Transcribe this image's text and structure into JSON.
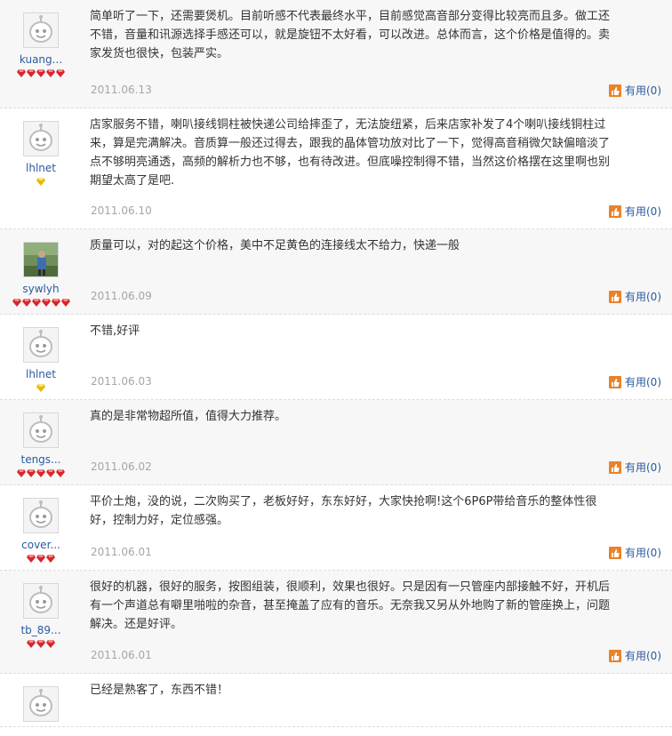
{
  "reviews": [
    {
      "username": "kuang...",
      "avatar": "default-face-icon",
      "rank": {
        "icon": "red-gem-icon",
        "count": 5
      },
      "text": "简单听了一下，还需要煲机。目前听感不代表最终水平，目前感觉高音部分变得比较亮而且多。做工还不错，音量和讯源选择手感还可以，就是旋钮不太好看，可以改进。总体而言，这个价格是值得的。卖家发货也很快，包装严实。",
      "date": "2011.06.13",
      "useful_label": "有用(0)"
    },
    {
      "username": "lhlnet",
      "avatar": "default-face-icon",
      "rank": {
        "icon": "yellow-diamond-icon",
        "count": 1
      },
      "text": "店家服务不错，喇叭接线铜柱被快递公司给摔歪了，无法旋纽紧，后来店家补发了4个喇叭接线铜柱过来，算是完满解决。音质算一般还过得去，跟我的晶体管功放对比了一下，觉得高音稍微欠缺偏暗淡了点不够明亮通透，高频的解析力也不够，也有待改进。但底噪控制得不错，当然这价格摆在这里啊也别期望太高了是吧.",
      "date": "2011.06.10",
      "useful_label": "有用(0)"
    },
    {
      "username": "sywlyh",
      "avatar": "user-photo",
      "rank": {
        "icon": "red-gem-icon",
        "count": 6
      },
      "text": "质量可以，对的起这个价格，美中不足黄色的连接线太不给力，快递一般",
      "date": "2011.06.09",
      "useful_label": "有用(0)"
    },
    {
      "username": "lhlnet",
      "avatar": "default-face-icon",
      "rank": {
        "icon": "yellow-diamond-icon",
        "count": 1
      },
      "text": "不错,好评",
      "date": "2011.06.03",
      "useful_label": "有用(0)"
    },
    {
      "username": "tengs...",
      "avatar": "default-face-icon",
      "rank": {
        "icon": "red-gem-icon",
        "count": 5
      },
      "text": "真的是非常物超所值，值得大力推荐。",
      "date": "2011.06.02",
      "useful_label": "有用(0)"
    },
    {
      "username": "cover...",
      "avatar": "default-face-icon",
      "rank": {
        "icon": "red-gem-icon",
        "count": 3
      },
      "text": "平价土炮，没的说，二次购买了，老板好好，东东好好，大家快抢啊!这个6P6P带给音乐的整体性很好，控制力好，定位感强。",
      "date": "2011.06.01",
      "useful_label": "有用(0)"
    },
    {
      "username": "tb_89...",
      "avatar": "default-face-icon",
      "rank": {
        "icon": "red-gem-icon",
        "count": 3
      },
      "text": "很好的机器，很好的服务，按图组装，很顺利，效果也很好。只是因有一只管座内部接触不好，开机后有一个声道总有噼里啪啦的杂音，甚至掩盖了应有的音乐。无奈我又另从外地购了新的管座换上，问题解决。还是好评。",
      "date": "2011.06.01",
      "useful_label": "有用(0)"
    },
    {
      "username": "",
      "avatar": "default-face-icon",
      "rank": {
        "icon": "red-gem-icon",
        "count": 0
      },
      "text": "已经是熟客了，东西不错！",
      "date": "",
      "useful_label": ""
    }
  ],
  "colors": {
    "link": "#2a5aa0",
    "date": "#a5a5a5",
    "alt_row": "#f7f7f7",
    "gem_red": "#d8262b",
    "diamond_yellow": "#e6b800",
    "useful_icon": "#e8832a"
  }
}
